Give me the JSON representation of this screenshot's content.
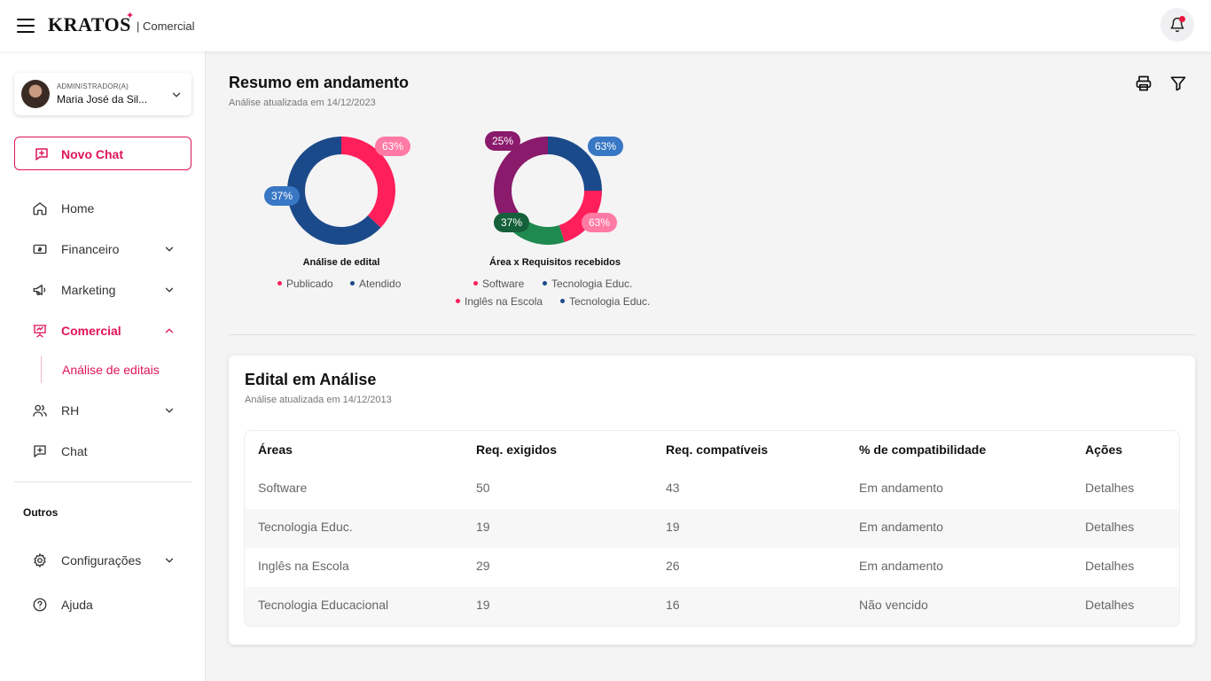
{
  "header": {
    "logo_text": "KRATOS",
    "logo_mark": "✦",
    "module": "| Comercial"
  },
  "user": {
    "role": "ADMINISTRADOR(A)",
    "name": "Maria José da Sil..."
  },
  "sidebar": {
    "new_chat_label": "Novo Chat",
    "items": [
      {
        "label": "Home",
        "icon": "home-icon"
      },
      {
        "label": "Financeiro",
        "icon": "money-icon"
      },
      {
        "label": "Marketing",
        "icon": "megaphone-icon"
      },
      {
        "label": "Comercial",
        "icon": "presentation-icon"
      },
      {
        "label": "RH",
        "icon": "users-icon"
      },
      {
        "label": "Chat",
        "icon": "chat-plus-icon"
      }
    ],
    "sub_item": "Análise de editais",
    "section_other": "Outros",
    "other_items": [
      {
        "label": "Configurações",
        "icon": "gear-icon"
      },
      {
        "label": "Ajuda",
        "icon": "help-icon"
      }
    ]
  },
  "summary": {
    "title": "Resumo em andamento",
    "subtitle": "Análise atualizada em 14/12/2023"
  },
  "colors": {
    "pink": "#ff1f5a",
    "pink_light": "#ff7aa5",
    "blue": "#1b4a8a",
    "blue_light": "#3877c4",
    "purple": "#8a1a6b",
    "green": "#1f8a50",
    "green_dark": "#14603a"
  },
  "chart_data": [
    {
      "type": "pie",
      "title": "Análise de edital",
      "slices": [
        {
          "label": "Publicado",
          "value": 37,
          "color": "#ff1f5a",
          "badge": "63%",
          "badge_color": "#ff7aa5"
        },
        {
          "label": "Atendido",
          "value": 63,
          "color": "#1b4a8a",
          "badge": "37%",
          "badge_color": "#3877c4"
        }
      ],
      "legend": [
        "Publicado",
        "Atendido"
      ]
    },
    {
      "type": "pie",
      "title": "Área x Requisitos recebidos",
      "slices": [
        {
          "label": "Software",
          "value": 25,
          "color": "#1b4a8a",
          "badge": "63%",
          "badge_color": "#3877c4"
        },
        {
          "label": "Tecnologia Educ.",
          "value": 20,
          "color": "#ff1f5a",
          "badge": "63%",
          "badge_color": "#ff7aa5"
        },
        {
          "label": "Inglês na Escola",
          "value": 20,
          "color": "#1f8a50",
          "badge": "37%",
          "badge_color": "#14603a"
        },
        {
          "label": "Tecnologia Educ.",
          "value": 35,
          "color": "#8a1a6b",
          "badge": "25%",
          "badge_color": "#8a1a6b"
        }
      ],
      "legend": [
        {
          "label": "Software",
          "color": "#ff1f5a"
        },
        {
          "label": "Tecnologia Educ.",
          "color": "#1b4a8a"
        },
        {
          "label": "Inglês na Escola",
          "color": "#ff1f5a"
        },
        {
          "label": "Tecnologia Educ.",
          "color": "#1b4a8a"
        }
      ]
    }
  ],
  "edital": {
    "title": "Edital em Análise",
    "subtitle": "Análise atualizada em 14/12/2013",
    "columns": [
      "Áreas",
      "Req. exigidos",
      "Req. compatíveis",
      "% de compatibilidade",
      "Ações"
    ],
    "rows": [
      [
        "Software",
        "50",
        "43",
        "Em andamento",
        "Detalhes"
      ],
      [
        "Tecnologia Educ.",
        "19",
        "19",
        "Em andamento",
        "Detalhes"
      ],
      [
        "Inglês na Escola",
        "29",
        "26",
        "Em andamento",
        "Detalhes"
      ],
      [
        "Tecnologia Educacional",
        "19",
        "16",
        "Não vencido",
        "Detalhes"
      ]
    ]
  }
}
